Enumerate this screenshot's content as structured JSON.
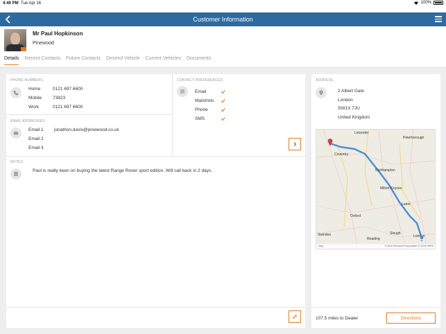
{
  "status_bar": {
    "time": "4:40 PM",
    "date": "Tue Apr 16",
    "battery": "100%"
  },
  "nav": {
    "title": "Customer Information"
  },
  "customer": {
    "name": "Mr Paul Hopkinson",
    "site": "Pinewood"
  },
  "tabs": [
    {
      "label": "Details",
      "active": true
    },
    {
      "label": "Recent Contacts"
    },
    {
      "label": "Future Contacts"
    },
    {
      "label": "Desired Vehicle"
    },
    {
      "label": "Current Vehicles"
    },
    {
      "label": "Documents"
    }
  ],
  "phone_numbers": {
    "heading": "PHONE NUMBERS",
    "rows": [
      {
        "label": "Home",
        "value": "0121 697 6600"
      },
      {
        "label": "Mobile",
        "value": "73823"
      },
      {
        "label": "Work",
        "value": "0121 697 6600"
      }
    ]
  },
  "contact_preferences": {
    "heading": "CONTACT PREFERENCES",
    "items": [
      {
        "label": "Email",
        "checked": true
      },
      {
        "label": "Mailshots",
        "checked": true
      },
      {
        "label": "Phone",
        "checked": true
      },
      {
        "label": "SMS",
        "checked": true
      }
    ]
  },
  "email_addresses": {
    "heading": "EMAIL ADDRESSES",
    "rows": [
      {
        "label": "Email 1",
        "value": "jonathon.davis@pinewood.co.uk"
      },
      {
        "label": "Email 2",
        "value": ""
      },
      {
        "label": "Email 3",
        "value": ""
      }
    ]
  },
  "notes": {
    "heading": "NOTES",
    "text": "Paul is really keen on buying the latest Range Rover sport edition. Will call back in 2 days."
  },
  "address": {
    "heading": "ADDRESS",
    "lines": [
      "2 Albert Gate",
      "London",
      "SW1X 7JU",
      "United Kingdom"
    ]
  },
  "map": {
    "labels": [
      "Leicester",
      "Peterborough",
      "Coventry",
      "Northampton",
      "Milton Keynes",
      "Luton",
      "Oxford",
      "Swindon",
      "Reading",
      "Slough",
      "London"
    ],
    "footer": "© 2019 Microsoft Corporation © 2019 HERE",
    "brand": "bing",
    "route_color": "#4a90d9"
  },
  "distance_text": "107.5 miles to Dealer",
  "directions_label": "Directions",
  "colors": {
    "accent": "#e37a1e",
    "nav": "#2d6aa0"
  }
}
